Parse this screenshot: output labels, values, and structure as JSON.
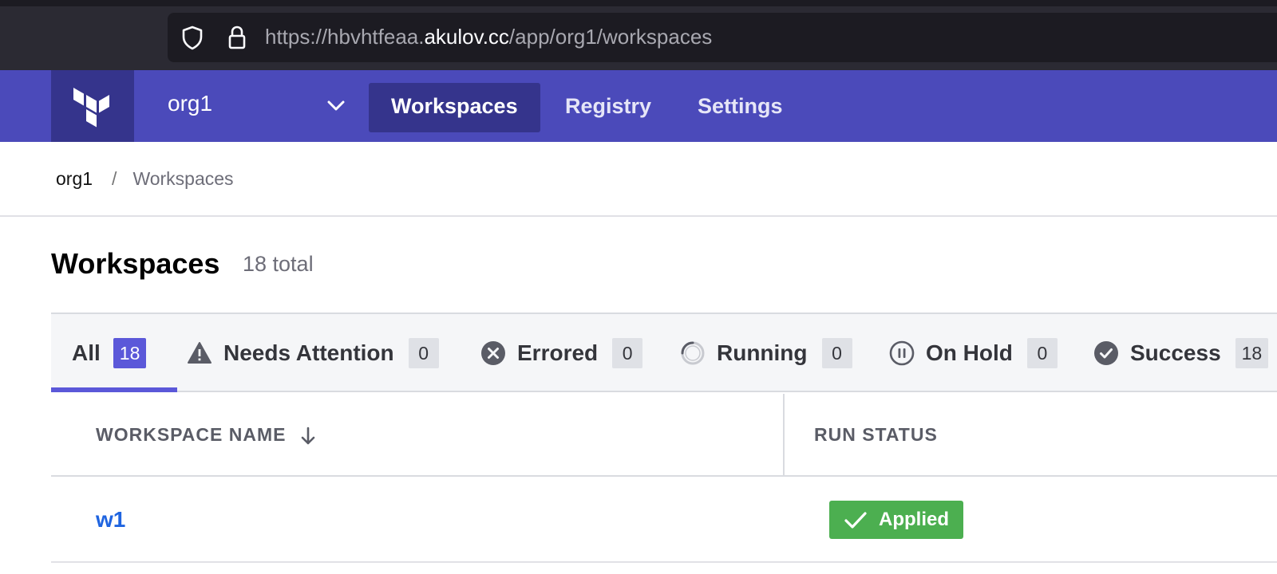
{
  "browser": {
    "url_prefix": "https://hbvhtfeaa.",
    "url_domain": "akulov.cc",
    "url_path": "/app/org1/workspaces",
    "icons": [
      "shield-icon",
      "lock-icon"
    ]
  },
  "appnav": {
    "logo": "terraform-logo-icon",
    "org_name": "org1",
    "tabs": [
      {
        "label": "Workspaces",
        "active": true
      },
      {
        "label": "Registry",
        "active": false
      },
      {
        "label": "Settings",
        "active": false
      }
    ]
  },
  "breadcrumb": {
    "root": "org1",
    "separator": "/",
    "current": "Workspaces"
  },
  "page": {
    "title": "Workspaces",
    "total": "18 total"
  },
  "filters": [
    {
      "label": "All",
      "count": "18",
      "icon": null,
      "active": true
    },
    {
      "label": "Needs Attention",
      "count": "0",
      "icon": "warning-icon"
    },
    {
      "label": "Errored",
      "count": "0",
      "icon": "error-circle-icon"
    },
    {
      "label": "Running",
      "count": "0",
      "icon": "spinner-icon"
    },
    {
      "label": "On Hold",
      "count": "0",
      "icon": "pause-circle-icon"
    },
    {
      "label": "Success",
      "count": "18",
      "icon": "check-circle-icon"
    }
  ],
  "table": {
    "columns": [
      "WORKSPACE NAME",
      "RUN STATUS"
    ],
    "rows": [
      {
        "name": "w1",
        "status": "Applied"
      }
    ]
  },
  "colors": {
    "nav_bg": "#4b4aba",
    "nav_active": "#35348c",
    "accent": "#5b58d9",
    "link": "#1f64e0",
    "success": "#4caf50"
  }
}
